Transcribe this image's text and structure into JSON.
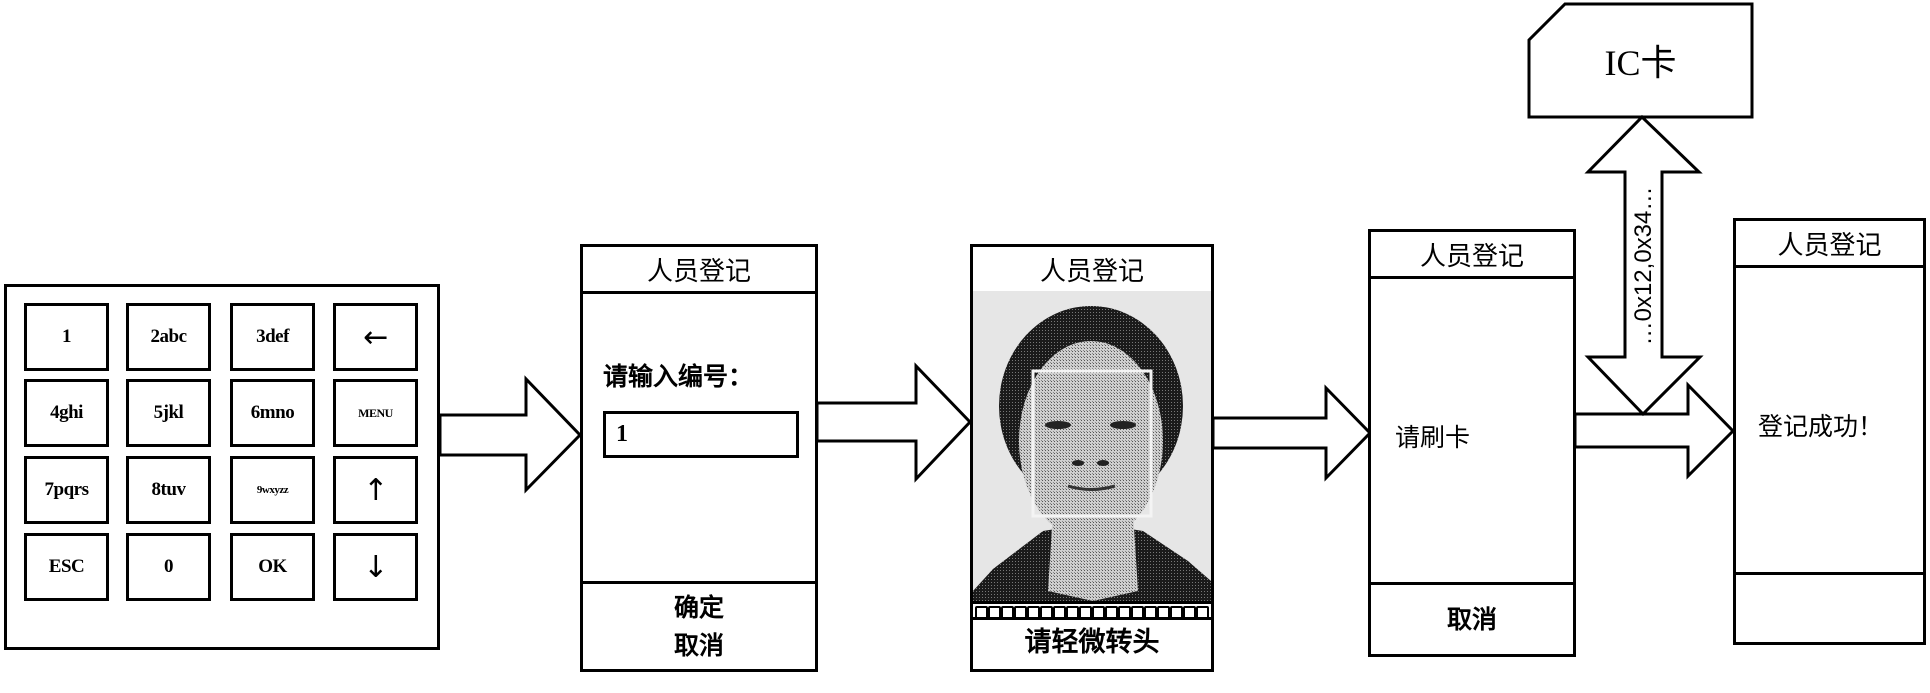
{
  "keypad": {
    "keys": [
      {
        "label": "1",
        "kind": "text"
      },
      {
        "label": "2abc",
        "kind": "text"
      },
      {
        "label": "3def",
        "kind": "text"
      },
      {
        "label": "",
        "kind": "icon",
        "icon": "backspace-arrow-left-icon",
        "glyph": "←"
      },
      {
        "label": "4ghi",
        "kind": "text"
      },
      {
        "label": "5jkl",
        "kind": "text"
      },
      {
        "label": "6mno",
        "kind": "text"
      },
      {
        "label": "MENU",
        "kind": "text"
      },
      {
        "label": "7pqrs",
        "kind": "text"
      },
      {
        "label": "8tuv",
        "kind": "text"
      },
      {
        "label": "9wxyzz",
        "kind": "text"
      },
      {
        "label": "",
        "kind": "icon",
        "icon": "arrow-up-icon",
        "glyph": "↑"
      },
      {
        "label": "ESC",
        "kind": "text"
      },
      {
        "label": "0",
        "kind": "text"
      },
      {
        "label": "OK",
        "kind": "text"
      },
      {
        "label": "",
        "kind": "icon",
        "icon": "arrow-down-icon",
        "glyph": "↓"
      }
    ]
  },
  "screens": {
    "input_id": {
      "title": "人员登记",
      "prompt": "请输入编号：",
      "input_value": "1",
      "confirm_label": "确定",
      "cancel_label": "取消"
    },
    "face_capture": {
      "title": "人员登记",
      "progress_cells": 18,
      "instruction": "请轻微转头"
    },
    "swipe_card": {
      "title": "人员登记",
      "prompt": "请刷卡",
      "cancel_label": "取消"
    },
    "success": {
      "title": "人员登记",
      "message": "登记成功！"
    }
  },
  "ic_card": {
    "label": "IC卡",
    "data_label": "…0x12,0x34…"
  },
  "colors": {
    "line": "#000000",
    "background": "#ffffff",
    "photo_bg": "#e8e8e8"
  }
}
